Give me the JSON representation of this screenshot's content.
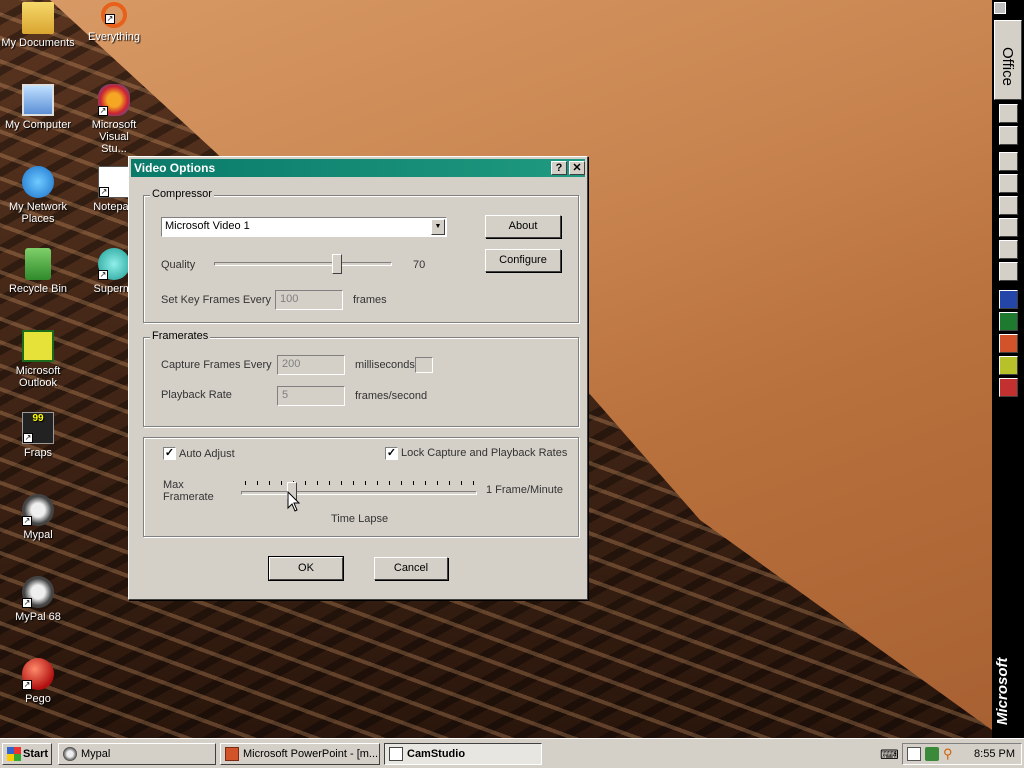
{
  "desktop": {
    "icons": [
      {
        "label": "My Documents"
      },
      {
        "label": "Everything"
      },
      {
        "label": "My Computer"
      },
      {
        "label": "Microsoft Visual Stu..."
      },
      {
        "label": "My Network Places"
      },
      {
        "label": "Notepad"
      },
      {
        "label": "Recycle Bin"
      },
      {
        "label": "Supermi"
      },
      {
        "label": "Microsoft Outlook"
      },
      {
        "label": "Fraps"
      },
      {
        "label": "Mypal"
      },
      {
        "label": "MyPal 68"
      },
      {
        "label": "Pego"
      }
    ]
  },
  "officebar": {
    "office_label": "Office",
    "brand": "Microsoft"
  },
  "dialog": {
    "title": "Video Options",
    "help_label": "?",
    "close_label": "✕",
    "compressor": {
      "group_label": "Compressor",
      "selected": "Microsoft Video 1",
      "about_label": "About",
      "configure_label": "Configure",
      "quality_label": "Quality",
      "quality_value": "70",
      "quality_percent": 70,
      "keyframes_label": "Set Key Frames Every",
      "keyframes_value": "100",
      "keyframes_unit": "frames"
    },
    "framerates": {
      "group_label": "Framerates",
      "capture_label": "Capture Frames Every",
      "capture_value": "200",
      "capture_unit": "milliseconds",
      "playback_label": "Playback Rate",
      "playback_value": "5",
      "playback_unit": "frames/second"
    },
    "timelapse": {
      "auto_adjust_label": "Auto Adjust",
      "auto_adjust_checked": true,
      "lock_label": "Lock Capture and Playback Rates",
      "lock_checked": true,
      "max_framerate_label_1": "Max",
      "max_framerate_label_2": "Framerate",
      "rate_text": "1 Frame/Minute",
      "caption": "Time Lapse"
    },
    "ok_label": "OK",
    "cancel_label": "Cancel"
  },
  "taskbar": {
    "start_label": "Start",
    "tasks": [
      {
        "label": "Mypal"
      },
      {
        "label": "Microsoft PowerPoint - [m..."
      },
      {
        "label": "CamStudio"
      }
    ],
    "clock": "8:55 PM"
  }
}
